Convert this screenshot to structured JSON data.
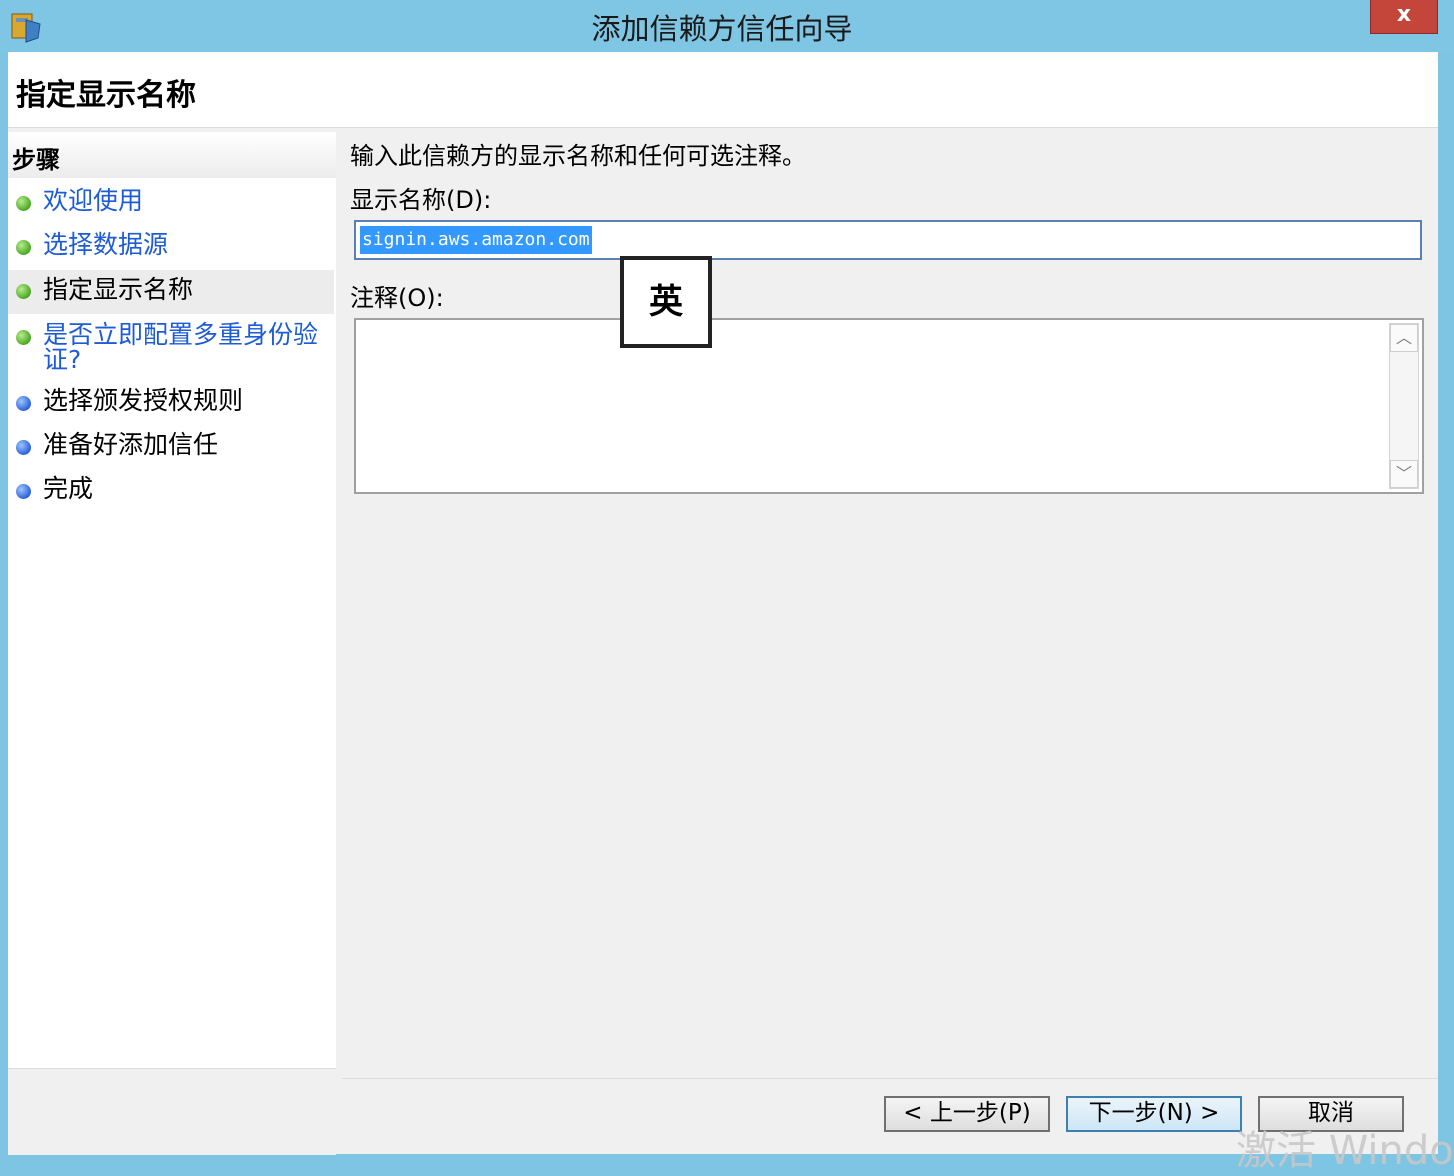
{
  "window": {
    "title": "添加信赖方信任向导",
    "close_label": "x",
    "app_icon": "server-shield-icon"
  },
  "header": {
    "title": "指定显示名称"
  },
  "steps": {
    "heading": "步骤",
    "items": [
      {
        "label": "欢迎使用",
        "status": "done",
        "link": true
      },
      {
        "label": "选择数据源",
        "status": "done",
        "link": true
      },
      {
        "label": "指定显示名称",
        "status": "current",
        "link": false
      },
      {
        "label": "是否立即配置多重身份验证?",
        "status": "done",
        "link": true
      },
      {
        "label": "选择颁发授权规则",
        "status": "pending",
        "link": false
      },
      {
        "label": "准备好添加信任",
        "status": "pending",
        "link": false
      },
      {
        "label": "完成",
        "status": "pending",
        "link": false
      }
    ]
  },
  "content": {
    "intro": "输入此信赖方的显示名称和任何可选注释。",
    "display_name_label": "显示名称(D):",
    "display_name_value": "signin.aws.amazon.com",
    "notes_label": "注释(O):",
    "notes_value": "",
    "ime_indicator": "英"
  },
  "buttons": {
    "back": "< 上一步(P)",
    "next": "下一步(N) >",
    "cancel": "取消"
  },
  "watermark": "激活 Windo",
  "colors": {
    "titlebar": "#7fc6e5",
    "link": "#1d5bd8",
    "selection": "#3399ff",
    "close": "#c4463a"
  }
}
